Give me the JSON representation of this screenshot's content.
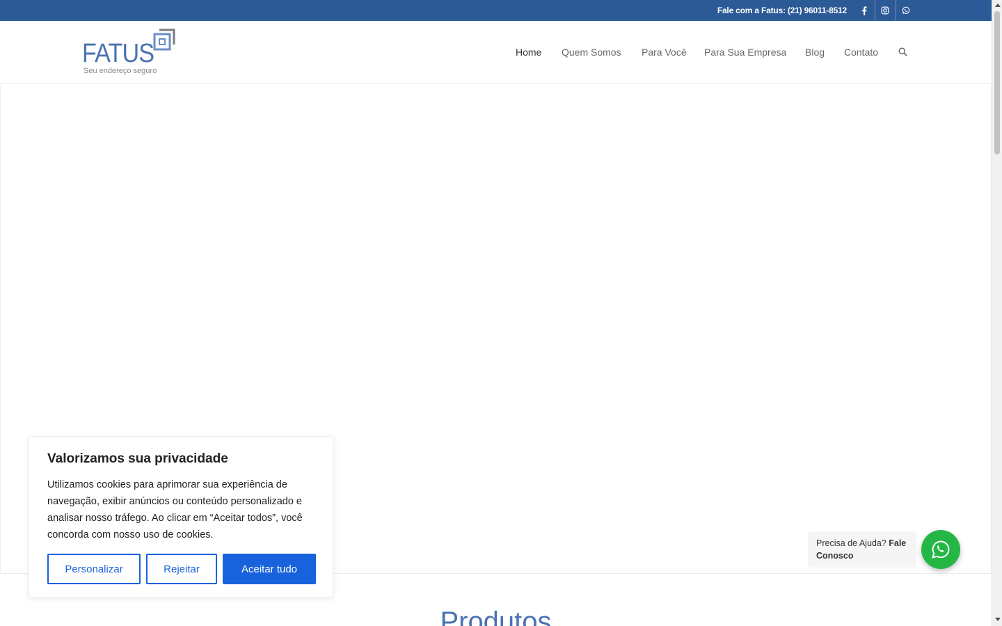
{
  "topbar": {
    "phone_label": "Fale com a Fatus: (21) 96011-8512",
    "social": [
      {
        "name": "facebook-icon"
      },
      {
        "name": "instagram-icon"
      },
      {
        "name": "whatsapp-icon"
      }
    ]
  },
  "logo": {
    "word": "FATUS",
    "tagline": "Seu endereço seguro"
  },
  "nav": {
    "items": [
      {
        "label": "Home",
        "active": true
      },
      {
        "label": "Quem Somos"
      },
      {
        "label": "Para Você"
      },
      {
        "label": "Para Sua Empresa"
      },
      {
        "label": "Blog"
      },
      {
        "label": "Contato"
      }
    ],
    "search_icon": "search-icon"
  },
  "section": {
    "title": "Produtos"
  },
  "cookie": {
    "title": "Valorizamos sua privacidade",
    "body": "Utilizamos cookies para aprimorar sua experiência de navegação, exibir anúncios ou conteúdo personalizado e analisar nosso tráfego. Ao clicar em “Aceitar todos”, você concorda com nosso uso de cookies.",
    "customize_label": "Personalizar",
    "reject_label": "Rejeitar",
    "accept_label": "Aceitar tudo"
  },
  "whatsapp": {
    "prompt": "Precisa de Ajuda?",
    "cta": "Fale Conosco"
  },
  "colors": {
    "topbar": "#2c5a97",
    "brand": "#4b73b3",
    "cookie_button": "#1863dc",
    "whatsapp": "#25b746"
  }
}
